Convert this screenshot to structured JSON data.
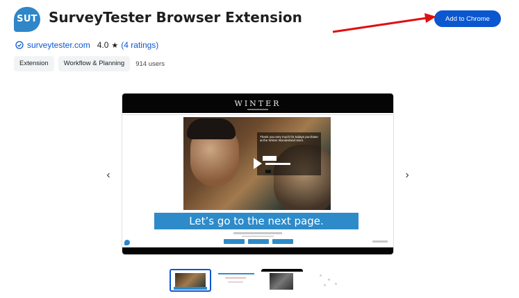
{
  "extension": {
    "logo_text": "SUT",
    "title": "SurveyTester Browser Extension",
    "website": "surveytester.com",
    "rating": "4.0",
    "ratings_count": "(4 ratings)",
    "users": "914 users"
  },
  "chips": [
    {
      "label": "Extension"
    },
    {
      "label": "Workflow & Planning"
    }
  ],
  "actions": {
    "add_label": "Add to Chrome"
  },
  "screenshot": {
    "brand": "WINTER",
    "cta_text": "Let’s go to the next page.",
    "overlay_text": "Thank you very much for todays purchase at the Winter Wonderland store."
  },
  "carousel": {
    "prev_glyph": "‹",
    "next_glyph": "›",
    "active_index": 0
  },
  "icons": {
    "verified": "verified-check-icon",
    "star": "star-icon",
    "play": "play-icon"
  },
  "colors": {
    "brand_blue": "#2f86c9",
    "button_blue": "#0b57d0",
    "arrow_red": "#e01010"
  }
}
